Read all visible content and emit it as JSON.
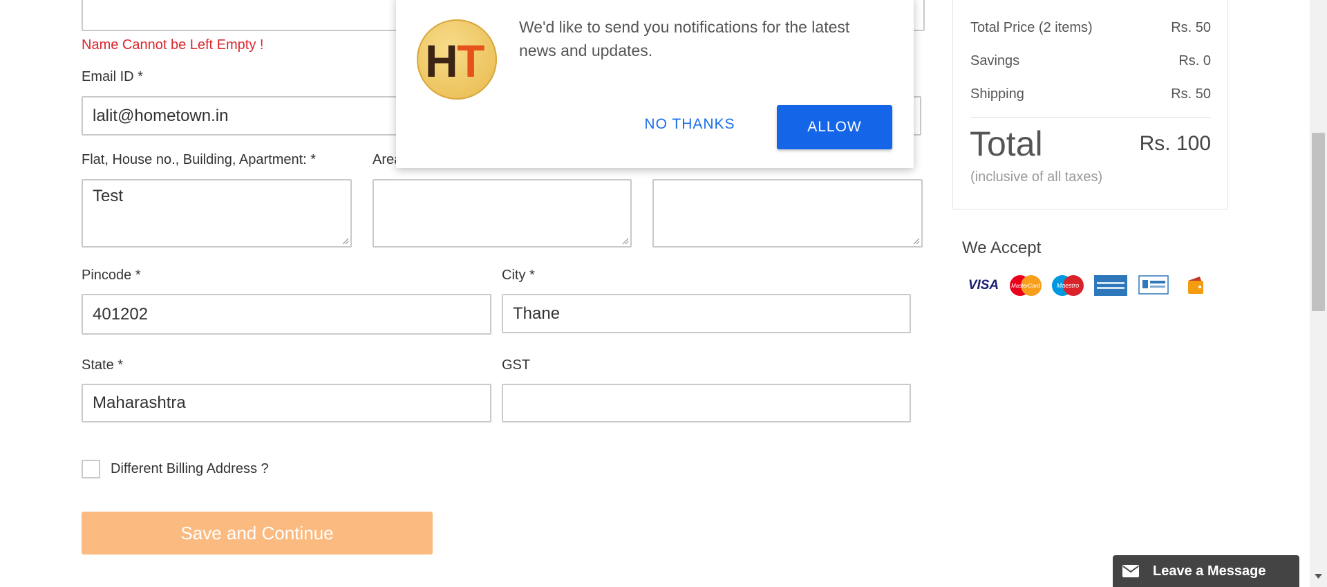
{
  "form": {
    "name_error": "Name Cannot be Left Empty !",
    "email_label": "Email ID *",
    "email_value": "lalit@hometown.in",
    "flat_label": "Flat, House no., Building, Apartment: *",
    "flat_value": "Test",
    "area_label_partial": "Area",
    "area_value": "",
    "landmark_value": "",
    "pincode_label": "Pincode *",
    "pincode_value": "401202",
    "city_label": "City *",
    "city_value": "Thane",
    "state_label": "State *",
    "state_value": "Maharashtra",
    "gst_label": "GST",
    "gst_value": "",
    "billing_label": "Different Billing Address ?",
    "billing_checked": false,
    "save_label": "Save and Continue"
  },
  "summary": {
    "total_price_label": "Total Price (2 items)",
    "total_price_value": "Rs. 50",
    "savings_label": "Savings",
    "savings_value": "Rs. 0",
    "shipping_label": "Shipping",
    "shipping_value": "Rs. 50",
    "total_label": "Total",
    "total_value": "Rs. 100",
    "inclusive": "(inclusive of all taxes)"
  },
  "payments": {
    "title": "We Accept",
    "methods": [
      "visa-icon",
      "mastercard-icon",
      "maestro-icon",
      "amex-icon",
      "netbanking-icon",
      "wallet-icon"
    ],
    "visa_text": "VISA",
    "mastercard_text": "MasterCard",
    "maestro_text": "Maestro"
  },
  "popup": {
    "logo_text": [
      "H",
      "T"
    ],
    "message": "We'd like to send you notifications for the latest news and updates.",
    "no_thanks": "NO THANKS",
    "allow": "ALLOW",
    "colors": {
      "allow": "#1565e8",
      "link": "#1a6ee8"
    }
  },
  "chat": {
    "label": "Leave a Message"
  },
  "colors": {
    "error": "#d9262c",
    "save_button": "#fbbb80"
  }
}
